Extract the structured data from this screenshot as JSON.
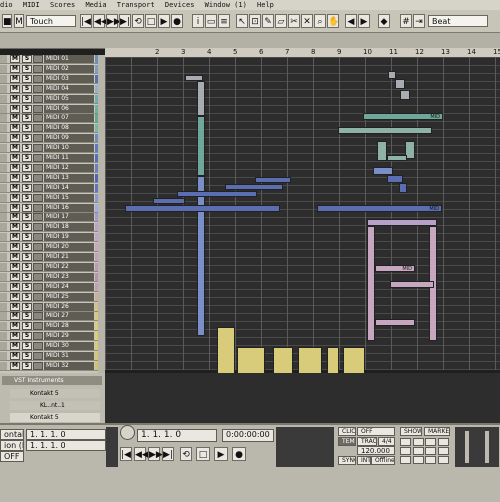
{
  "menu": [
    "dio",
    "MIDI",
    "Scores",
    "Media",
    "Transport",
    "Devices",
    "Window (1)",
    "Help"
  ],
  "toolbar": {
    "automation_mode": "Touch",
    "quantize": "Beat"
  },
  "ruler_ticks": [
    "2",
    "3",
    "4",
    "5",
    "6",
    "7",
    "8",
    "9",
    "10",
    "11",
    "12",
    "13",
    "14",
    "15"
  ],
  "tracks": [
    {
      "name": "MIDI 01",
      "color": "#6b8fb5"
    },
    {
      "name": "MIDI 02",
      "color": "#7aa0c0"
    },
    {
      "name": "MIDI 03",
      "color": "#5c6fb0"
    },
    {
      "name": "MIDI 04",
      "color": "#8fb4c8"
    },
    {
      "name": "MIDI 05",
      "color": "#77a9b2"
    },
    {
      "name": "MIDI 06",
      "color": "#6fb2a2"
    },
    {
      "name": "MIDI 07",
      "color": "#64a98e"
    },
    {
      "name": "MIDI 08",
      "color": "#79b7a4"
    },
    {
      "name": "MIDI 09",
      "color": "#6a8dc4"
    },
    {
      "name": "MIDI 10",
      "color": "#5b7cc2"
    },
    {
      "name": "MIDI 11",
      "color": "#5570b8"
    },
    {
      "name": "MIDI 12",
      "color": "#6a7fc6"
    },
    {
      "name": "MIDI 13",
      "color": "#5067b4"
    },
    {
      "name": "MIDI 14",
      "color": "#6274c0"
    },
    {
      "name": "MIDI 15",
      "color": "#8a9bd0"
    },
    {
      "name": "MIDI 16",
      "color": "#9bb0dc"
    },
    {
      "name": "MIDI 17",
      "color": "#a59ad0"
    },
    {
      "name": "MIDI 18",
      "color": "#b8a2cf"
    },
    {
      "name": "MIDI 19",
      "color": "#c2a6c9"
    },
    {
      "name": "MIDI 20",
      "color": "#caa8c5"
    },
    {
      "name": "MIDI 21",
      "color": "#c79fc1"
    },
    {
      "name": "MIDI 22",
      "color": "#bf98bd"
    },
    {
      "name": "MIDI 23",
      "color": "#b692b9"
    },
    {
      "name": "MIDI 24",
      "color": "#c4a0b8"
    },
    {
      "name": "MIDI 25",
      "color": "#cfae9a"
    },
    {
      "name": "MIDI 26",
      "color": "#d6c08a"
    },
    {
      "name": "MIDI 27",
      "color": "#d8c97e"
    },
    {
      "name": "MIDI 28",
      "color": "#d9cf7a"
    },
    {
      "name": "MIDI 29",
      "color": "#dccf72"
    },
    {
      "name": "MIDI 30",
      "color": "#d7cc70"
    },
    {
      "name": "MIDI 31",
      "color": "#d3c86e"
    },
    {
      "name": "MIDI 32",
      "color": "#cfc46c"
    }
  ],
  "vst": {
    "folder": "VST Instruments",
    "instrument1": "Kontakt 5",
    "instrument1_short": "KL..nt..1",
    "instrument2": "Kontakt 5"
  },
  "transport": {
    "left_label1": "ontakt",
    "left_label2": "ion (MID) -",
    "left_label3": "OFF",
    "locator_left": "1. 1. 1. 0",
    "locator_right": "1. 1. 1. 0",
    "position_bars": "1. 1. 1.  0",
    "position_time": "0:00:00:00",
    "click_label": "CLICK",
    "click_value": "OFF",
    "tempo_label": "TEMPO",
    "tempo_track": "TRACK",
    "signature": "4/4",
    "tempo_value": "120.000",
    "sync_label": "SYNC",
    "sync_source": "INT.",
    "sync_mode": "Offline",
    "show": "SHOW",
    "marker": "MARKER"
  },
  "note_labels": {
    "midi_tag": "MID"
  }
}
